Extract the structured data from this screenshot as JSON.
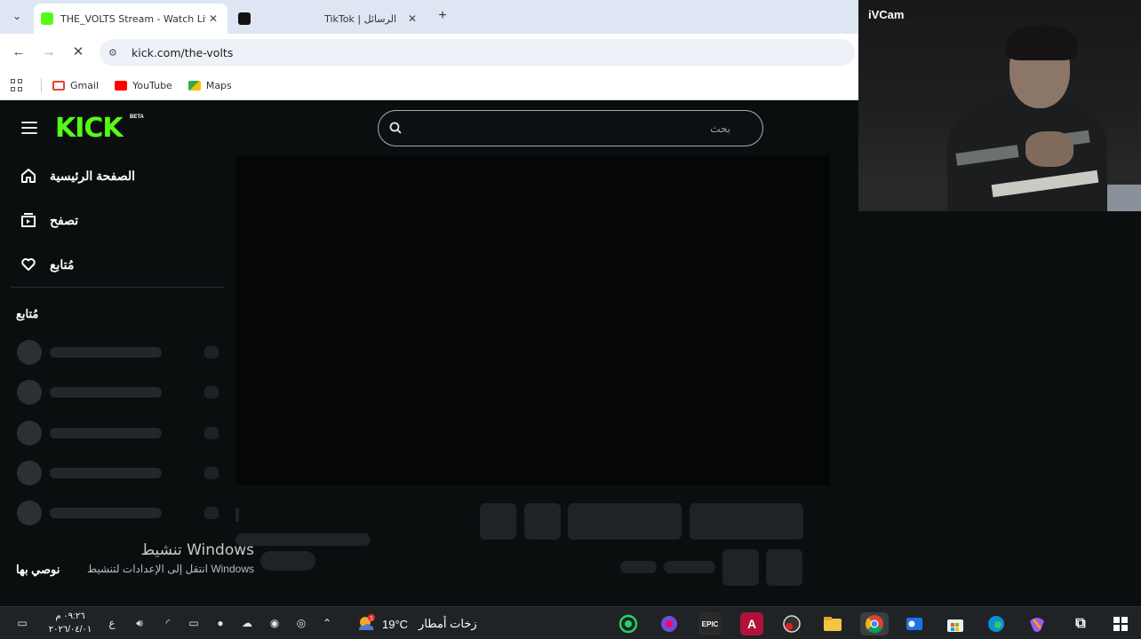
{
  "browser": {
    "tabs": [
      {
        "title": "THE_VOLTS Stream - Watch Live",
        "active": true
      },
      {
        "title": "TikTok | الرسائل",
        "active": false
      }
    ],
    "url": "kick.com/the-volts",
    "bookmarks": [
      "Gmail",
      "YouTube",
      "Maps"
    ]
  },
  "kick": {
    "logo": "KICK",
    "beta": "BETA",
    "search_placeholder": "بحث",
    "nav": [
      {
        "label": "الصفحة الرئيسية",
        "icon": "home-icon"
      },
      {
        "label": "تصفح",
        "icon": "browse-icon"
      },
      {
        "label": "مُتابع",
        "icon": "heart-icon"
      }
    ],
    "following_title": "مُتابع",
    "recommended_title": "نوصي بها"
  },
  "windows_activation": {
    "title": "تنشيط Windows",
    "subtitle": "انتقل إلى الإعدادات لتنشيط Windows"
  },
  "webcam": {
    "label": "iVCam"
  },
  "taskbar": {
    "time": "٠٩:٢٦ م",
    "date": "٢٠٢٦/٠٤/٠١",
    "lang": "ع",
    "weather_temp": "19°C",
    "weather_desc": "زخات أمطار",
    "weather_badge": "1",
    "epic_label": "EPIC"
  },
  "colors": {
    "kick_green": "#53fc18",
    "page_bg": "#0b0e0f",
    "chrome_tabbar": "#dfe6f3"
  }
}
